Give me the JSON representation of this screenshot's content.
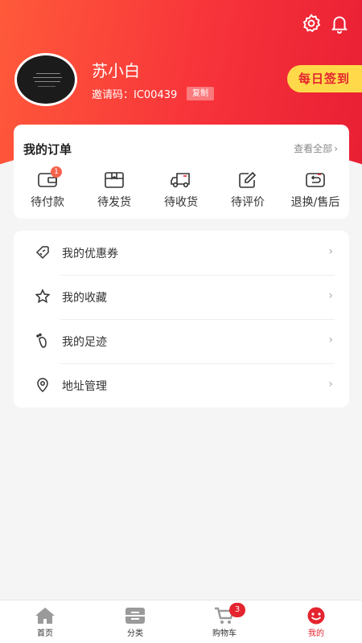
{
  "header": {
    "username": "苏小白",
    "invite_text": "邀请码：IC00439",
    "copy_label": "复制",
    "checkin_label": "每日签到"
  },
  "orders": {
    "title": "我的订单",
    "view_all": "查看全部",
    "items": [
      {
        "label": "待付款",
        "icon": "wallet-icon",
        "badge": "1"
      },
      {
        "label": "待发货",
        "icon": "package-icon"
      },
      {
        "label": "待收货",
        "icon": "truck-icon"
      },
      {
        "label": "待评价",
        "icon": "edit-icon"
      },
      {
        "label": "退换/售后",
        "icon": "return-icon"
      }
    ]
  },
  "menu": [
    {
      "label": "我的优惠券",
      "icon": "coupon-icon"
    },
    {
      "label": "我的收藏",
      "icon": "star-icon"
    },
    {
      "label": "我的足迹",
      "icon": "footprint-icon"
    },
    {
      "label": "地址管理",
      "icon": "location-icon"
    }
  ],
  "tabbar": {
    "items": [
      {
        "label": "首页",
        "icon": "home-icon"
      },
      {
        "label": "分类",
        "icon": "category-icon"
      },
      {
        "label": "购物车",
        "icon": "cart-icon",
        "badge": "3"
      },
      {
        "label": "我的",
        "icon": "smile-icon",
        "active": true
      }
    ]
  },
  "colors": {
    "brand_red": "#e4242f",
    "checkin_yellow": "#ffd94a",
    "background": "#f5f5f5"
  }
}
